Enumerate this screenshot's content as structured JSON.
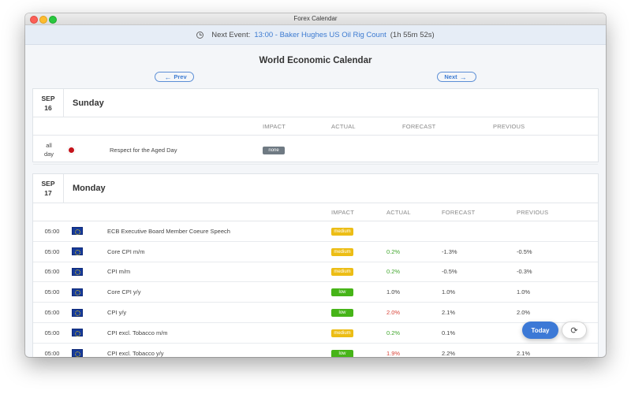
{
  "window": {
    "title": "Forex Calendar"
  },
  "next_event": {
    "label": "Next Event:",
    "event": "13:00 - Baker Hughes US Oil Rig Count",
    "countdown": "(1h 55m 52s)"
  },
  "page_title": "World Economic Calendar",
  "nav": {
    "prev": "Prev",
    "next": "Next"
  },
  "columns": {
    "impact": "IMPACT",
    "actual": "ACTUAL",
    "forecast": "FORECAST",
    "previous": "PREVIOUS"
  },
  "days": [
    {
      "month": "SEP",
      "date": "16",
      "weekday": "Sunday",
      "events": [
        {
          "time_line1": "all",
          "time_line2": "day",
          "flag": "jp-flag",
          "name": "Respect for the Aged Day",
          "impact": "none",
          "actual": "",
          "forecast": "",
          "previous": ""
        }
      ]
    },
    {
      "month": "SEP",
      "date": "17",
      "weekday": "Monday",
      "events": [
        {
          "time": "05:00",
          "flag": "eu-flag",
          "name": "ECB Executive Board Member Coeure Speech",
          "impact": "medium",
          "actual": "",
          "forecast": "",
          "previous": ""
        },
        {
          "time": "05:00",
          "flag": "eu-flag",
          "name": "Core CPI m/m",
          "impact": "medium",
          "actual": "0.2%",
          "forecast": "-1.3%",
          "previous": "-0.5%"
        },
        {
          "time": "05:00",
          "flag": "eu-flag",
          "name": "CPI m/m",
          "impact": "medium",
          "actual": "0.2%",
          "forecast": "-0.5%",
          "previous": "-0.3%"
        },
        {
          "time": "05:00",
          "flag": "eu-flag",
          "name": "Core CPI y/y",
          "impact": "low",
          "actual": "1.0%",
          "forecast": "1.0%",
          "previous": "1.0%"
        },
        {
          "time": "05:00",
          "flag": "eu-flag",
          "name": "CPI y/y",
          "impact": "low",
          "actual": "2.0%",
          "forecast": "2.1%",
          "previous": "2.0%"
        },
        {
          "time": "05:00",
          "flag": "eu-flag",
          "name": "CPI excl. Tobacco m/m",
          "impact": "medium",
          "actual": "0.2%",
          "forecast": "0.1%",
          "previous": ""
        },
        {
          "time": "05:00",
          "flag": "eu-flag",
          "name": "CPI excl. Tobacco y/y",
          "impact": "low",
          "actual": "1.9%",
          "forecast": "2.2%",
          "previous": "2.1%"
        }
      ]
    }
  ],
  "buttons": {
    "today": "Today",
    "refresh_icon": "refresh-icon"
  },
  "colors": {
    "accent": "#3c79d6",
    "medium": "#ecbd15",
    "low": "#46b418",
    "none": "#6f7a83",
    "positive": "#43a72f",
    "negative": "#d9453a"
  }
}
